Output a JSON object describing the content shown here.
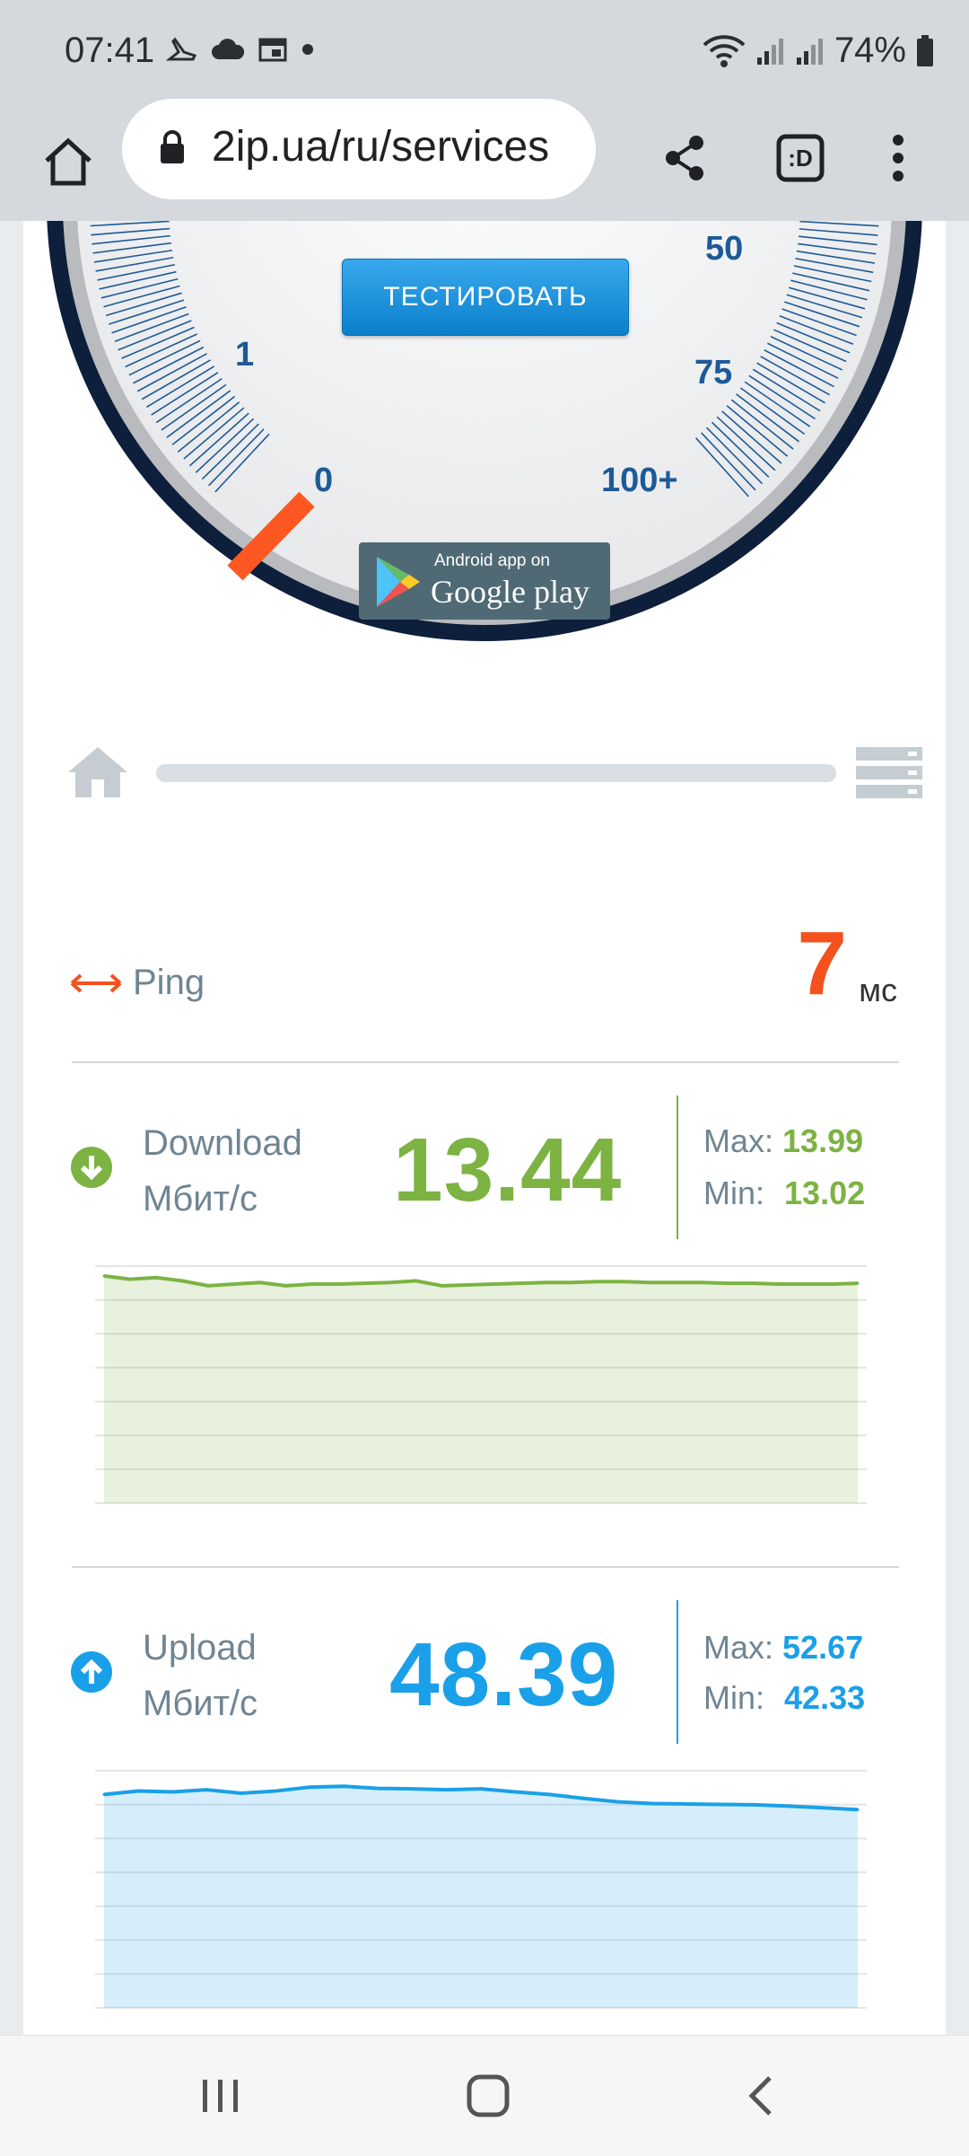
{
  "status_bar": {
    "time": "07:41",
    "battery": "74%",
    "left_icons": [
      "shoes-icon",
      "cloud-icon",
      "calendar-icon",
      "dot-icon"
    ],
    "right_icons": [
      "wifi-icon",
      "signal-icon",
      "signal-icon",
      "battery-icon"
    ]
  },
  "browser": {
    "url": "2ip.ua/ru/services",
    "buttons": [
      "home-icon",
      "share-icon",
      "tab-switcher-icon",
      "menu-icon"
    ],
    "tab_label": ":D"
  },
  "gauge": {
    "test_button": "ТЕСТИРОВАТЬ",
    "labels": {
      "zero": "0",
      "one": "1",
      "fifty": "50",
      "seventy_five": "75",
      "hundred": "100+"
    },
    "store_small": "Android app on",
    "store_big": "Google play"
  },
  "ping": {
    "label": "Ping",
    "value": "7",
    "unit": "мс",
    "color": "#f4511e"
  },
  "download": {
    "label": "Download",
    "unit": "Мбит/с",
    "value": "13.44",
    "max_label": "Max:",
    "max": "13.99",
    "min_label": "Min:",
    "min": "13.02",
    "color": "#7cb342"
  },
  "upload": {
    "label": "Upload",
    "unit": "Мбит/с",
    "value": "48.39",
    "max_label": "Max:",
    "max": "52.67",
    "min_label": "Min:",
    "min": "42.33",
    "color": "#1aa0e8"
  },
  "chart_data": [
    {
      "type": "area",
      "name": "",
      "values": [
        13.9,
        13.7,
        13.8,
        13.6,
        13.3,
        13.4,
        13.5,
        13.3,
        13.4,
        13.4,
        13.45,
        13.5,
        13.6,
        13.3,
        13.35,
        13.4,
        13.45,
        13.5,
        13.5,
        13.55,
        13.55,
        13.5,
        13.5,
        13.5,
        13.45,
        13.45,
        13.4,
        13.4,
        13.4,
        13.45
      ],
      "ylim": [
        0,
        14.5
      ]
    },
    {
      "type": "area",
      "name": "",
      "values": [
        49.5,
        50.3,
        50.1,
        50.6,
        49.8,
        50.3,
        51.2,
        51.4,
        50.9,
        50.8,
        50.6,
        50.8,
        50.1,
        49.5,
        48.6,
        47.8,
        47.4,
        47.3,
        47.2,
        47.1,
        46.8,
        46.4,
        46.0
      ],
      "ylim": [
        0,
        55
      ]
    }
  ],
  "navbar": {
    "buttons": [
      "recent-apps-icon",
      "home-nav-icon",
      "back-icon"
    ]
  }
}
